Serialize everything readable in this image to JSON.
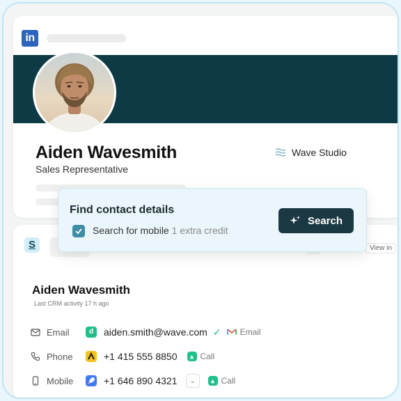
{
  "linkedin": {
    "logo_text": "in",
    "brand_color": "#2d64bc",
    "banner_color": "#0e3a45"
  },
  "profile": {
    "name": "Aiden Wavesmith",
    "title": "Sales Representative",
    "company": "Wave Studio",
    "company_icon": "waves-icon"
  },
  "popup": {
    "title": "Find contact details",
    "option_label": "Search for mobile",
    "option_credit": "1 extra credit",
    "option_checked": true,
    "search_label": "Search",
    "search_icon": "sparkle-icon"
  },
  "crm": {
    "logo_text": "S",
    "view_in_label": "View in",
    "contact_name": "Aiden Wavesmith",
    "last_activity": "Last CRM activity 17 h ago",
    "rows": [
      {
        "icon": "mail-icon",
        "label": "Email",
        "source_icon": "d",
        "source_color": "#21c08b",
        "value": "aiden.smith@wave.com",
        "verified": true,
        "action": "Email",
        "action_icon": "gmail-icon"
      },
      {
        "icon": "phone-icon",
        "label": "Phone",
        "source_icon": "arrow-source-icon",
        "source_color": "#f7c21a",
        "value": "+1 415 555 8850",
        "action": "Call",
        "action_icon": "call-app-icon"
      },
      {
        "icon": "mobile-icon",
        "label": "Mobile",
        "source_icon": "rocket-icon",
        "source_color": "#3e7bf0",
        "value": "+1 646 890 4321",
        "has_dropdown": true,
        "action": "Call",
        "action_icon": "call-app-icon"
      }
    ]
  }
}
